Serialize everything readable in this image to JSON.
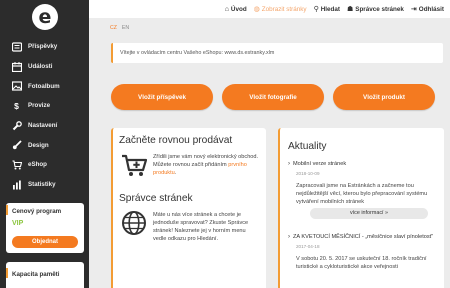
{
  "brand": {
    "logo_letter": "e"
  },
  "sidebar": {
    "items": [
      {
        "label": "Příspěvky",
        "icon": "posts-icon"
      },
      {
        "label": "Události",
        "icon": "calendar-icon"
      },
      {
        "label": "Fotoalbum",
        "icon": "photo-icon"
      },
      {
        "label": "Provize",
        "icon": "dollar-icon"
      },
      {
        "label": "Nastavení",
        "icon": "wrench-icon"
      },
      {
        "label": "Design",
        "icon": "brush-icon"
      },
      {
        "label": "eShop",
        "icon": "cart-icon"
      },
      {
        "label": "Statistiky",
        "icon": "stats-icon"
      }
    ],
    "promo": {
      "title": "Cenový program",
      "plan": "VIP",
      "button": "Objednat"
    },
    "capacity": {
      "title": "Kapacita paměti"
    }
  },
  "topbar": {
    "links": [
      {
        "label": "Úvod",
        "icon": "home-icon"
      },
      {
        "label": "Zobrazit stránky",
        "icon": "globe-icon"
      },
      {
        "label": "Hledat",
        "icon": "search-icon"
      },
      {
        "label": "Správce stránek",
        "icon": "user-icon"
      },
      {
        "label": "Odhlásit",
        "icon": "logout-icon"
      }
    ]
  },
  "lang": {
    "active": "CZ",
    "other": "EN"
  },
  "welcome": "Vítejte v ovládacím centru Vašeho eShopu: www.ds.estranky.xlm",
  "actions": {
    "add_post": "Vložit příspěvek",
    "add_photo": "Vložit fotografie",
    "add_product": "Vložit produkt"
  },
  "start": {
    "title": "Začněte rovnou prodávat",
    "text_before": "Zřídili jsme vám nový elektronický obchod. Můžete rovnou začít přidáním ",
    "link": "prvního produktu",
    "text_after": ".",
    "manager_title": "Správce stránek",
    "manager_text": "Máte u nás více stránek a chcete je jednoduše spravovat? Zkuste Správce stránek! Naleznete jej v horním menu vedle odkazu pro Hledání."
  },
  "news": {
    "title": "Aktuality",
    "items": [
      {
        "title": "Mobilní verze stránek",
        "date": "2018-10-09",
        "body": "Zapracovali jsme na Estránkách a začneme tou nejdůležitější věcí, kterou bylo přepracování systému vytváření mobilních stránek",
        "more": "více informací »"
      },
      {
        "title": "ZA KVETOUCÍ MĚSÍČNICÍ - „měsíčnice slaví pínoletost\"",
        "date": "2017-04-18",
        "body": "V sobotu 20. 5. 2017 se uskuteční 18. ročník tradiční turistické a cykloturistické akce veřejnosti"
      }
    ]
  },
  "colors": {
    "accent": "#f47a20",
    "sidebar_bg": "#2c2c2c",
    "vip": "#8cc63f"
  }
}
